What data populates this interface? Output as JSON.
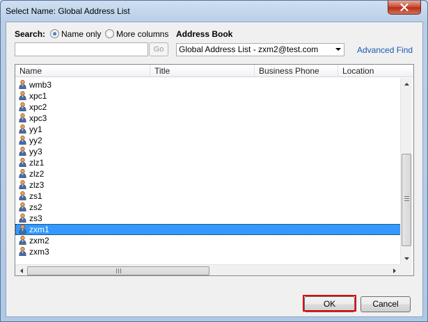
{
  "window": {
    "title": "Select Name: Global Address List"
  },
  "search": {
    "label": "Search:",
    "option_name_only": "Name only",
    "option_more_columns": "More columns",
    "selected_option": "Name only",
    "input_value": "",
    "go_label": "Go"
  },
  "address_book": {
    "label": "Address Book",
    "selected": "Global Address List - zxm2@test.com",
    "advanced_find": "Advanced Find"
  },
  "table": {
    "columns": [
      "Name",
      "Title",
      "Business Phone",
      "Location"
    ],
    "rows": [
      {
        "name": "wmb3",
        "selected": false
      },
      {
        "name": "xpc1",
        "selected": false
      },
      {
        "name": "xpc2",
        "selected": false
      },
      {
        "name": "xpc3",
        "selected": false
      },
      {
        "name": "yy1",
        "selected": false
      },
      {
        "name": "yy2",
        "selected": false
      },
      {
        "name": "yy3",
        "selected": false
      },
      {
        "name": "zlz1",
        "selected": false
      },
      {
        "name": "zlz2",
        "selected": false
      },
      {
        "name": "zlz3",
        "selected": false
      },
      {
        "name": "zs1",
        "selected": false
      },
      {
        "name": "zs2",
        "selected": false
      },
      {
        "name": "zs3",
        "selected": false
      },
      {
        "name": "zxm1",
        "selected": true
      },
      {
        "name": "zxm2",
        "selected": false
      },
      {
        "name": "zxm3",
        "selected": false
      }
    ],
    "row_icon": "person-icon"
  },
  "buttons": {
    "ok": "OK",
    "cancel": "Cancel"
  },
  "colors": {
    "selection": "#3399ff",
    "link": "#1a58b4",
    "highlight_box": "#e10000"
  }
}
